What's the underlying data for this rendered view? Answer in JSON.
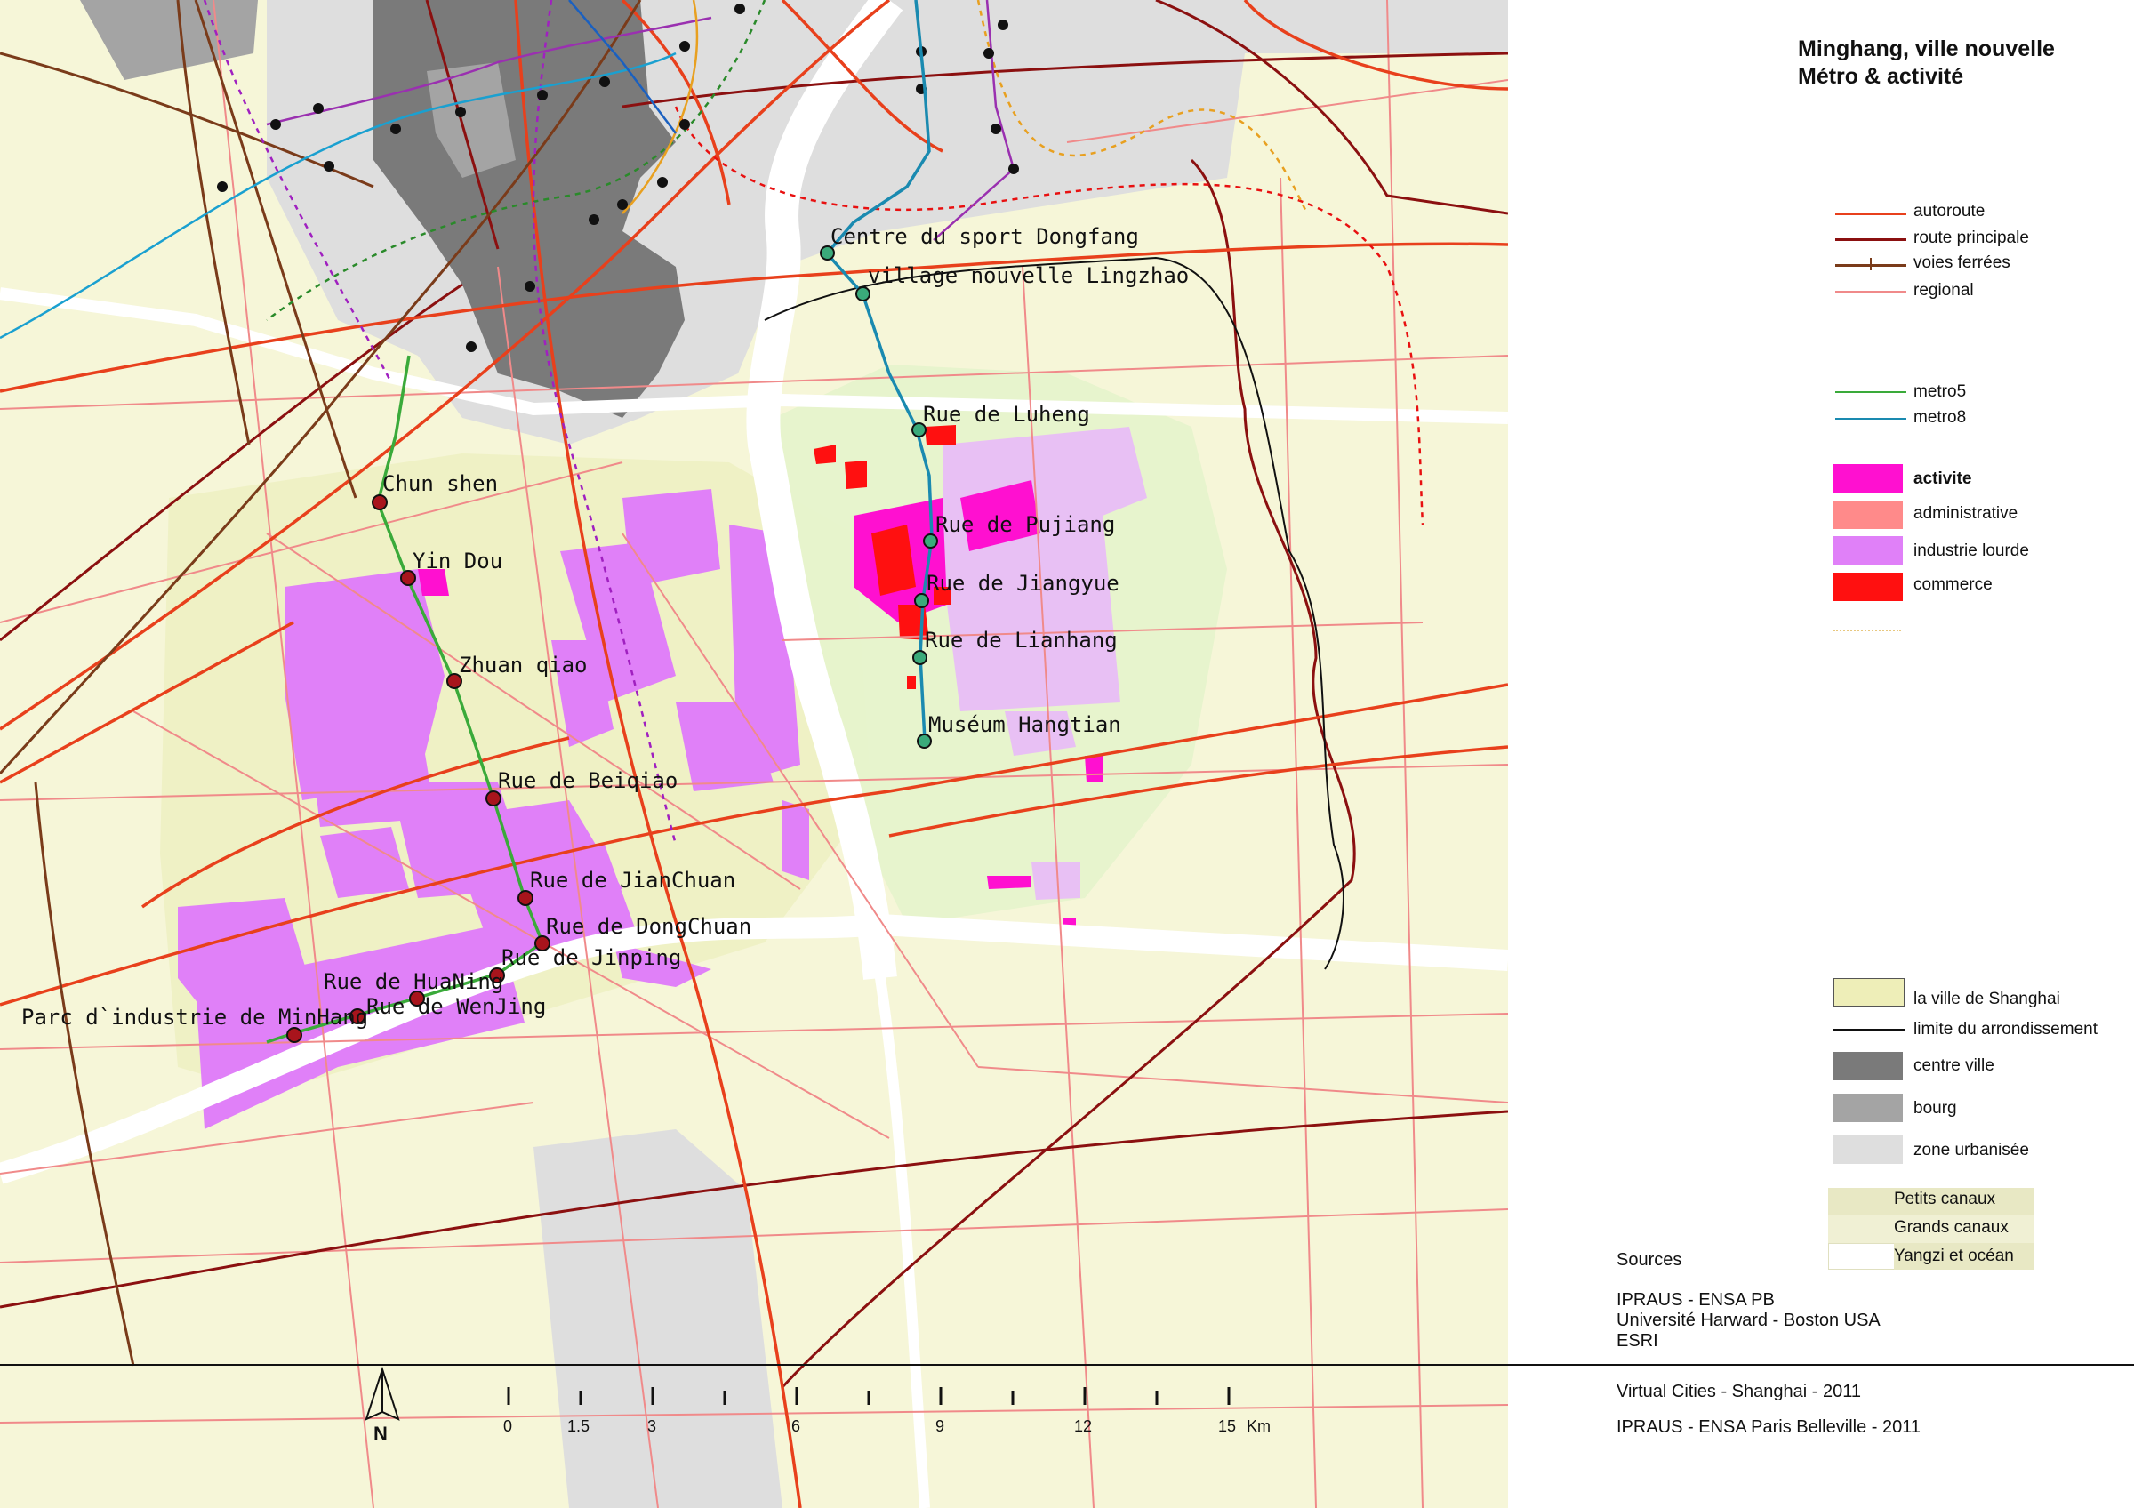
{
  "title": {
    "line1": "Minghang, ville nouvelle",
    "line2": "Métro & activité"
  },
  "legend_lines": [
    {
      "label": "autoroute",
      "color": "#e8401c",
      "style": "solid"
    },
    {
      "label": "route principale",
      "color": "#8b1010",
      "style": "solid"
    },
    {
      "label": "voies ferrées",
      "color": "#7a3b1a",
      "style": "rail"
    },
    {
      "label": "regional",
      "color": "#f08a8a",
      "style": "solid"
    },
    {
      "label": "metro5",
      "color": "#3aaa3a",
      "style": "solid"
    },
    {
      "label": "metro8",
      "color": "#1a8ab0",
      "style": "solid"
    }
  ],
  "legend_areas": [
    {
      "label": "activite",
      "color": "#ff10d0",
      "bold": true
    },
    {
      "label": "administrative",
      "color": "#ff8a8a",
      "bold": false
    },
    {
      "label": "industrie lourde",
      "color": "#e080f8",
      "bold": false
    },
    {
      "label": "commerce",
      "color": "#ff1010",
      "bold": false
    }
  ],
  "legend_base": [
    {
      "label": "la ville de Shanghai",
      "color": "#eeeeb8",
      "kind": "box"
    },
    {
      "label": "limite du arrondissement",
      "color": "#111111",
      "kind": "line"
    },
    {
      "label": "centre ville",
      "color": "#7a7a7a",
      "kind": "box"
    },
    {
      "label": "bourg",
      "color": "#a4a4a4",
      "kind": "box"
    },
    {
      "label": "zone urbanisée",
      "color": "#dedede",
      "kind": "box"
    }
  ],
  "legend_water": [
    {
      "label": "Petits canaux",
      "color": "#e8e8c4"
    },
    {
      "label": "Grands canaux",
      "color": "#f0f0d4"
    },
    {
      "label": "Yangzi et océan",
      "color": "#ffffff"
    }
  ],
  "sources": {
    "heading": "Sources",
    "lines": [
      "IPRAUS - ENSA PB",
      "Université Harward - Boston USA",
      "ESRI"
    ]
  },
  "credits": {
    "line1": "Virtual Cities - Shanghai - 2011",
    "line2": "IPRAUS - ENSA Paris Belleville - 2011"
  },
  "scale": {
    "ticks": [
      "0",
      "1.5",
      "3",
      "6",
      "9",
      "12",
      "15"
    ],
    "unit": "Km",
    "north": "N"
  },
  "stations_metro5": [
    "Chun shen",
    "Yin Dou",
    "Zhuan qiao",
    "Rue de Beiqiao",
    "Rue de JianChuan",
    "Rue de DongChuan",
    "Rue de Jinping",
    "Rue de HuaNing",
    "Rue de WenJing",
    "Parc d`industrie de MinHang"
  ],
  "stations_metro8": [
    "Centre du sport Dongfang",
    "village nouvelle Lingzhao",
    "Rue de Luheng",
    "Rue de Pujiang",
    "Rue de Jiangyue",
    "Rue de Lianhang",
    "Muséum Hangtian"
  ]
}
